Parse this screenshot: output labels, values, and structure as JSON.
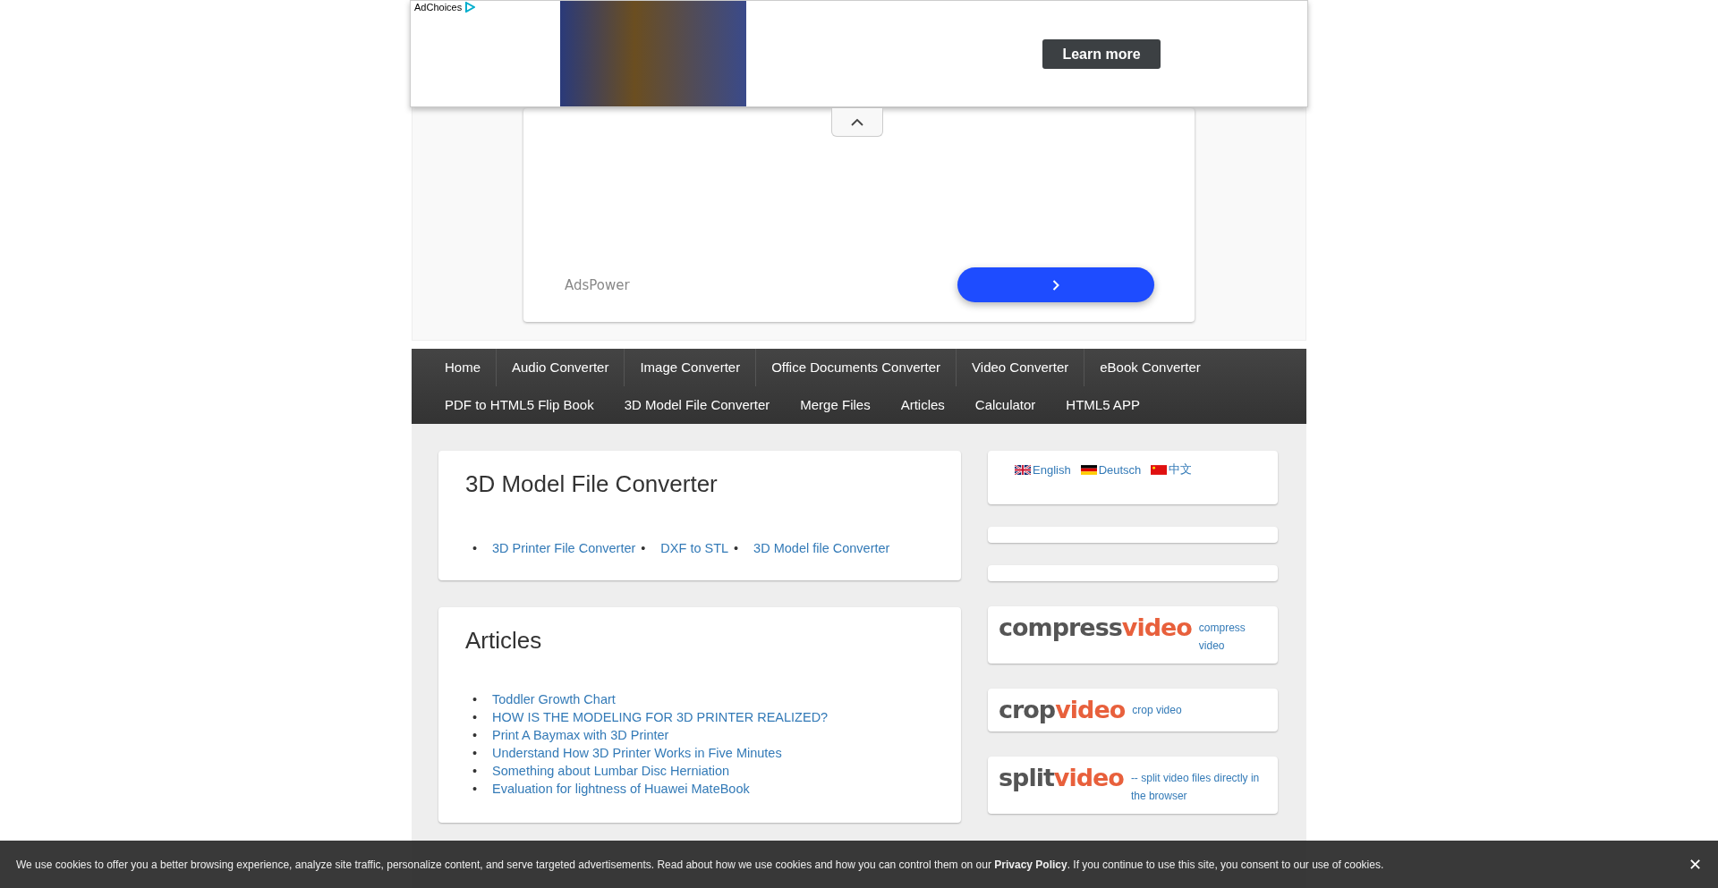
{
  "top_ad": {
    "adchoices": "AdChoices",
    "cta": "Learn more"
  },
  "native_ad": {
    "advertiser": "AdsPower"
  },
  "nav": [
    {
      "label": "Home"
    },
    {
      "label": "Audio Converter"
    },
    {
      "label": "Image Converter"
    },
    {
      "label": "Office Documents Converter"
    },
    {
      "label": "Video Converter"
    },
    {
      "label": "eBook Converter"
    },
    {
      "label": "PDF to HTML5 Flip Book"
    },
    {
      "label": "3D Model File Converter"
    },
    {
      "label": "Merge Files"
    },
    {
      "label": "Articles"
    },
    {
      "label": "Calculator"
    },
    {
      "label": "HTML5 APP"
    }
  ],
  "sections": [
    {
      "title": "3D Model File Converter",
      "kind": "inline",
      "bullet": "•",
      "links": [
        "3D Printer File Converter",
        "DXF to STL",
        "3D Model file Converter"
      ]
    },
    {
      "title": "Articles",
      "kind": "list",
      "bullet": "•",
      "links": [
        "Toddler Growth Chart",
        "HOW IS THE MODELING FOR 3D PRINTER REALIZED?",
        "Print A Baymax with 3D Printer",
        "Understand How 3D Printer Works in Five Minutes",
        "Something about Lumbar Disc Herniation",
        "Evaluation for lightness of Huawei MateBook"
      ]
    }
  ],
  "languages": [
    {
      "label": "English",
      "kind": "uk"
    },
    {
      "label": "Deutsch",
      "kind": "de"
    },
    {
      "label": "中文",
      "kind": "cn"
    }
  ],
  "tools": [
    {
      "logo_a": "compress",
      "logo_b": "video",
      "text": "compress video"
    },
    {
      "logo_a": "crop",
      "logo_b": "video",
      "text": "crop video"
    },
    {
      "logo_a": "split",
      "logo_b": "video",
      "text": "-- split video files directly in the browser"
    }
  ],
  "cookie_bar": {
    "text": "We use cookies to offer you a better browsing experience, analyze site traffic, personalize content, and serve targeted advertisements. Read about how we use cookies and how you can control them on our **Privacy Policy**. If you continue to use this site, you consent to our use of cookies.",
    "close": "✕"
  }
}
